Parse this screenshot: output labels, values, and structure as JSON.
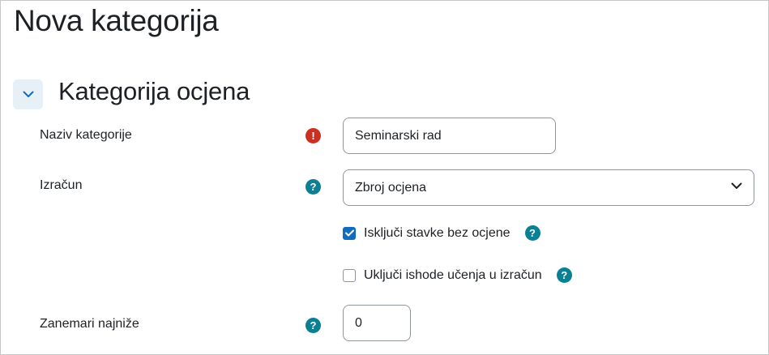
{
  "page": {
    "title": "Nova kategorija"
  },
  "section": {
    "title": "Kategorija ocjena",
    "expanded": true
  },
  "fields": {
    "category_name": {
      "label": "Naziv kategorije",
      "value": "Seminarski rad",
      "required": true
    },
    "calculation": {
      "label": "Izračun",
      "selected": "Zbroj ocjena"
    },
    "exclude_empty": {
      "label": "Isključi stavke bez ocjene",
      "checked": true
    },
    "include_outcomes": {
      "label": "Uključi ishode učenja u izračun",
      "checked": false
    },
    "drop_lowest": {
      "label": "Zanemari najniže",
      "value": "0"
    }
  },
  "icons": {
    "required": "exclamation-icon",
    "help": "question-icon",
    "collapse": "chevron-down-icon",
    "select": "chevron-down-icon"
  },
  "colors": {
    "required": "#ca3120",
    "help": "#0b7f94",
    "accent": "#0f6cbf",
    "collapse_bg": "#e7f0f7"
  },
  "glyphs": {
    "required": "!",
    "help": "?"
  }
}
